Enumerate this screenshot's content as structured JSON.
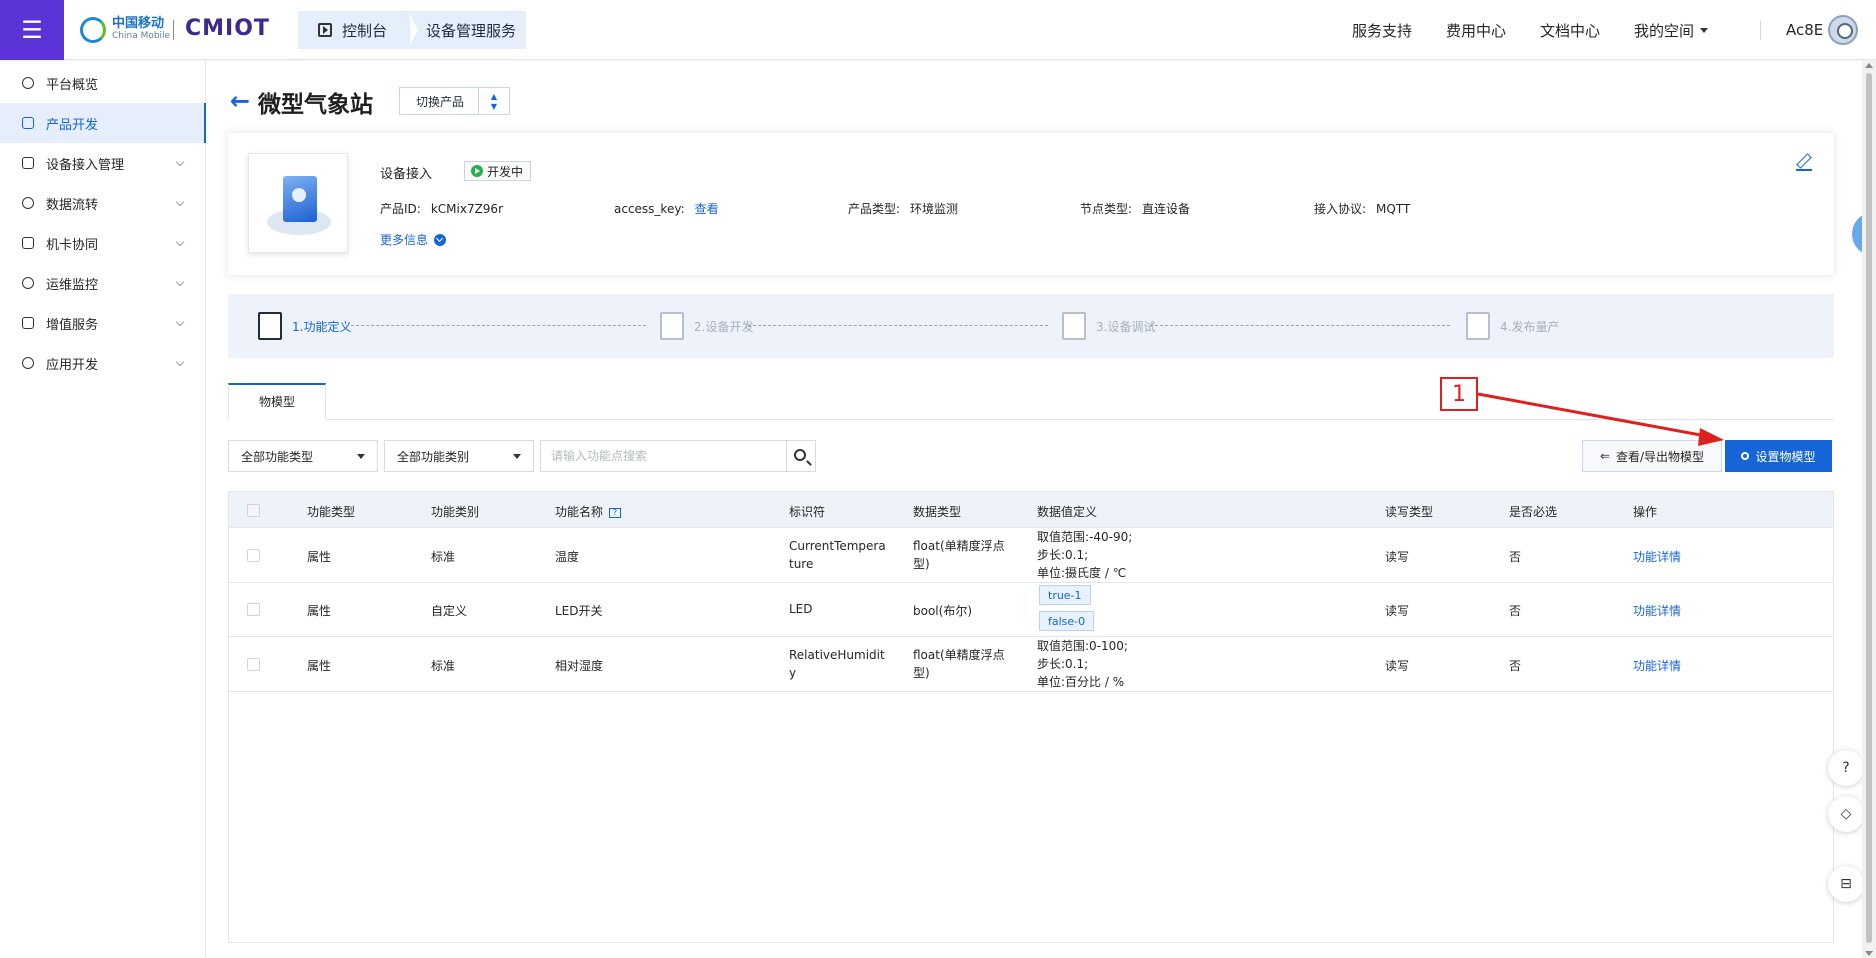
{
  "topbar": {
    "menu_icon": "menu-icon",
    "logo_cn": "中国移动",
    "logo_en": "China Mobile",
    "logo_brand": "CMIOT",
    "crumbs": [
      "控制台",
      "设备管理服务"
    ],
    "nav": [
      "服务支持",
      "费用中心",
      "文档中心",
      "我的空间"
    ],
    "user": "Ac8E"
  },
  "sidebar": {
    "items": [
      {
        "label": "平台概览",
        "icon": "overview-icon"
      },
      {
        "label": "产品开发",
        "icon": "cube-icon"
      },
      {
        "label": "设备接入管理",
        "icon": "device-icon"
      },
      {
        "label": "数据流转",
        "icon": "flow-icon"
      },
      {
        "label": "机卡协同",
        "icon": "link-icon"
      },
      {
        "label": "运维监控",
        "icon": "monitor-icon"
      },
      {
        "label": "增值服务",
        "icon": "send-icon"
      },
      {
        "label": "应用开发",
        "icon": "code-icon"
      }
    ]
  },
  "product": {
    "title": "微型气象站",
    "switch_label": "切换产品",
    "name": "设备接入",
    "status": "开发中",
    "id_label": "产品ID:",
    "id_value": "kCMix7Z96r",
    "ak_label": "access_key:",
    "ak_link": "查看",
    "type_label": "产品类型:",
    "type_value": "环境监测",
    "node_label": "节点类型:",
    "node_value": "直连设备",
    "proto_label": "接入协议:",
    "proto_value": "MQTT",
    "more_info": "更多信息"
  },
  "steps": [
    "1.功能定义",
    "2.设备开发",
    "3.设备调试",
    "4.发布量产"
  ],
  "tab": "物模型",
  "annotation": "1",
  "filters": {
    "type": "全部功能类型",
    "category": "全部功能类别",
    "search_placeholder": "请输入功能点搜索"
  },
  "buttons": {
    "view": "查看/导出物模型",
    "set": "设置物模型"
  },
  "table": {
    "headers": [
      "功能类型",
      "功能类别",
      "功能名称",
      "标识符",
      "数据类型",
      "数据值定义",
      "读写类型",
      "是否必选",
      "操作"
    ],
    "help_mark": "?",
    "rows": [
      {
        "type": "属性",
        "category": "标准",
        "name": "温度",
        "id1": "CurrentTempera",
        "id2": "ture",
        "dtype1": "float(单精度浮点",
        "dtype2": "型)",
        "def1": "取值范围:-40-90;",
        "def2": "步长:0.1;",
        "def3": "单位:摄氏度 / ℃",
        "rw": "读写",
        "required": "否",
        "action": "功能详情"
      },
      {
        "type": "属性",
        "category": "自定义",
        "name": "LED开关",
        "id1": "LED",
        "dtype1": "bool(布尔)",
        "tag1": "true-1",
        "tag2": "false-0",
        "rw": "读写",
        "required": "否",
        "action": "功能详情"
      },
      {
        "type": "属性",
        "category": "标准",
        "name": "相对湿度",
        "id1": "RelativeHumidit",
        "id2": "y",
        "dtype1": "float(单精度浮点",
        "dtype2": "型)",
        "def1": "取值范围:0-100;",
        "def2": "步长:0.1;",
        "def3": "单位:百分比 / %",
        "rw": "读写",
        "required": "否",
        "action": "功能详情"
      }
    ]
  },
  "colors": {
    "brand": "#5b33d6",
    "primary": "#1665d8",
    "annotation": "#e02020"
  }
}
